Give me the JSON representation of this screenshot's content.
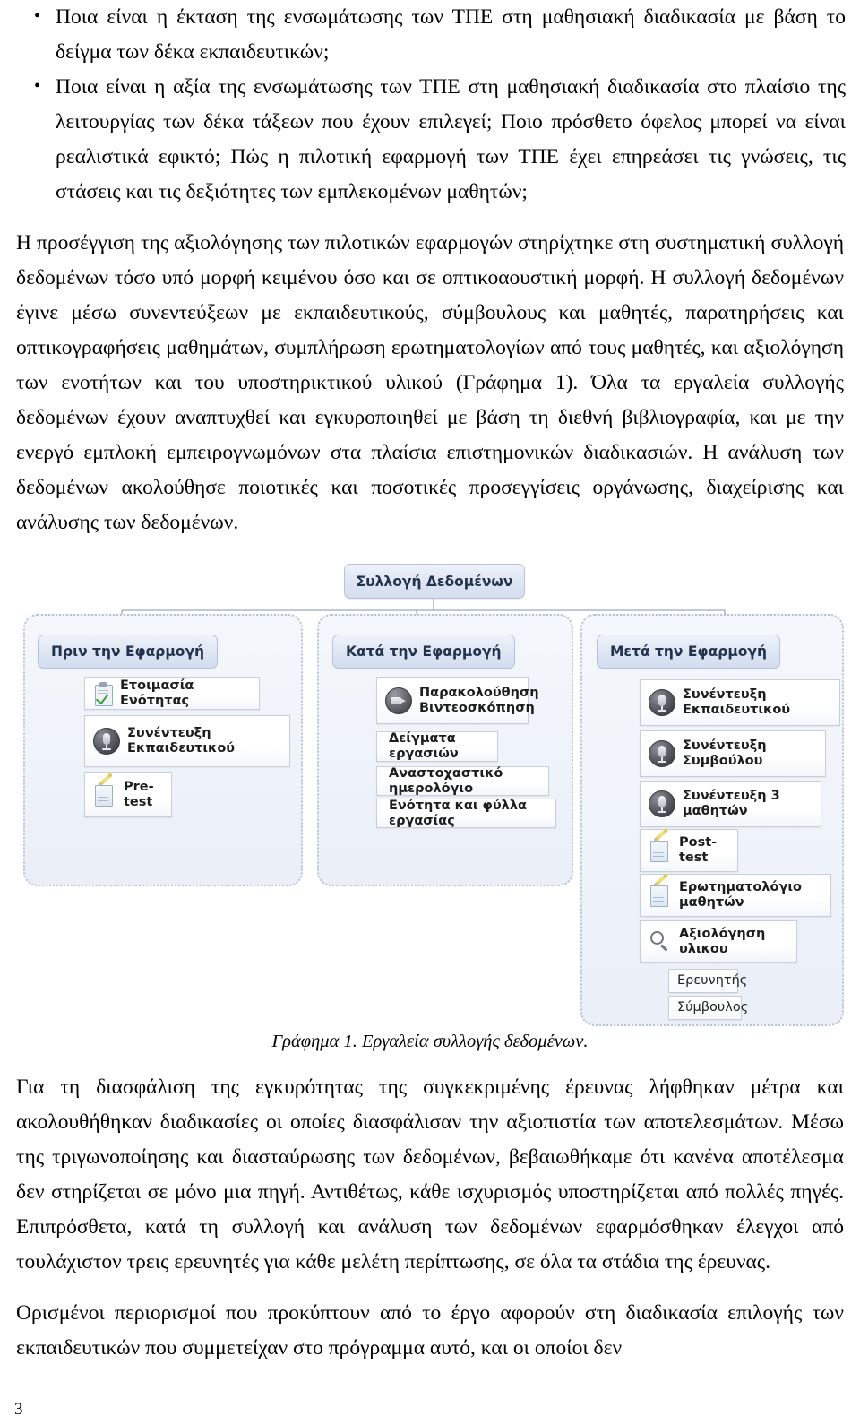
{
  "bullets": [
    "Ποια είναι η έκταση της ενσωμάτωσης των ΤΠΕ στη μαθησιακή διαδικασία με βάση το δείγμα των δέκα εκπαιδευτικών;",
    "Ποια είναι η αξία της ενσωμάτωσης των ΤΠΕ στη μαθησιακή διαδικασία στο πλαίσιο της λειτουργίας των δέκα τάξεων που έχουν επιλεγεί; Ποιο πρόσθετο όφελος μπορεί να είναι ρεαλιστικά εφικτό; Πώς η πιλοτική εφαρμογή των ΤΠΕ έχει επηρεάσει τις γνώσεις, τις στάσεις και τις δεξιότητες των εμπλεκομένων μαθητών;"
  ],
  "paragraphs": {
    "methodology": "Η προσέγγιση της αξιολόγησης των πιλοτικών εφαρμογών στηρίχτηκε  στη συστηματική συλλογή δεδομένων τόσο υπό μορφή  κειμένου όσο και σε οπτικοαουστική μορφή. Η συλλογή δεδομένων έγινε μέσω συνεντεύξεων με εκπαιδευτικούς, σύμβουλους και μαθητές, παρατηρήσεις και οπτικογραφήσεις μαθημάτων, συμπλήρωση ερωτηματολογίων από τους μαθητές, και αξιολόγηση των ενοτήτων και του υποστηρικτικού υλικού (Γράφημα 1). Όλα τα εργαλεία συλλογής δεδομένων έχουν αναπτυχθεί και εγκυροποιηθεί με βάση τη διεθνή βιβλιογραφία,  και με την ενεργό εμπλοκή εμπειρογνωμόνων στα πλαίσια επιστημονικών διαδικασιών. Η ανάλυση των δεδομένων ακολούθησε ποιοτικές και ποσοτικές προσεγγίσεις οργάνωσης, διαχείρισης και ανάλυσης των δεδομένων.",
    "validity": "Για τη διασφάλιση της εγκυρότητας της συγκεκριμένης έρευνας λήφθηκαν μέτρα και ακολουθήθηκαν διαδικασίες οι οποίες διασφάλισαν την αξιοπιστία των αποτελεσμάτων. Μέσω της τριγωνοποίησης και διασταύρωσης των δεδομένων, βεβαιωθήκαμε ότι κανένα αποτέλεσμα δεν στηρίζεται σε μόνο μια πηγή. Αντιθέτως, κάθε ισχυρισμός υποστηρίζεται από πολλές πηγές. Επιπρόσθετα, κατά τη συλλογή και ανάλυση των δεδομένων εφαρμόσθηκαν έλεγχοι από τουλάχιστον τρεις ερευνητές για κάθε μελέτη περίπτωσης, σε όλα τα στάδια της έρευνας.",
    "limitations": "Ορισμένοι περιορισμοί που προκύπτουν από το έργο αφορούν στη διαδικασία επιλογής των εκπαιδευτικών που συμμετείχαν στο πρόγραμμα αυτό, και οι οποίοι δεν"
  },
  "figure": {
    "caption": "Γράφημα 1. Εργαλεία συλλογής δεδομένων.",
    "root": "Συλλογή Δεδομένων",
    "groups": [
      {
        "title": "Πριν την Εφαρμογή",
        "items": [
          {
            "label": "Ετοιμασία Ενότητας",
            "icon": "clipboard-check-icon"
          },
          {
            "label": "Συνέντευξη Εκπαιδευτικού",
            "icon": "microphone-icon"
          },
          {
            "label": "Pre-test",
            "icon": "notepad-pencil-icon"
          }
        ]
      },
      {
        "title": "Κατά την Εφαρμογή",
        "items": [
          {
            "label": "Παρακολούθηση\nΒιντεοσκόπηση",
            "icon": "video-camera-icon"
          },
          {
            "label": "Δείγματα εργασιών",
            "icon": "none"
          },
          {
            "label": "Αναστοχαστικό ημερολόγιο",
            "icon": "none"
          },
          {
            "label": "Ενότητα και φύλλα εργασίας",
            "icon": "none"
          }
        ]
      },
      {
        "title": "Μετά την Εφαρμογή",
        "items": [
          {
            "label": "Συνέντευξη Εκπαιδευτικού",
            "icon": "microphone-icon"
          },
          {
            "label": "Συνέντευξη Συμβούλου",
            "icon": "microphone-icon"
          },
          {
            "label": "Συνέντευξη 3 μαθητών",
            "icon": "microphone-icon"
          },
          {
            "label": "Post-test",
            "icon": "notepad-pencil-icon"
          },
          {
            "label": "Ερωτηματολόγιο μαθητών",
            "icon": "notepad-pencil-icon"
          },
          {
            "label": "Αξιολόγηση υλικου",
            "icon": "magnifier-icon"
          }
        ],
        "subitems": [
          {
            "label": "Ερευνητής"
          },
          {
            "label": "Σύμβουλος"
          }
        ]
      }
    ]
  },
  "page_number": "3"
}
